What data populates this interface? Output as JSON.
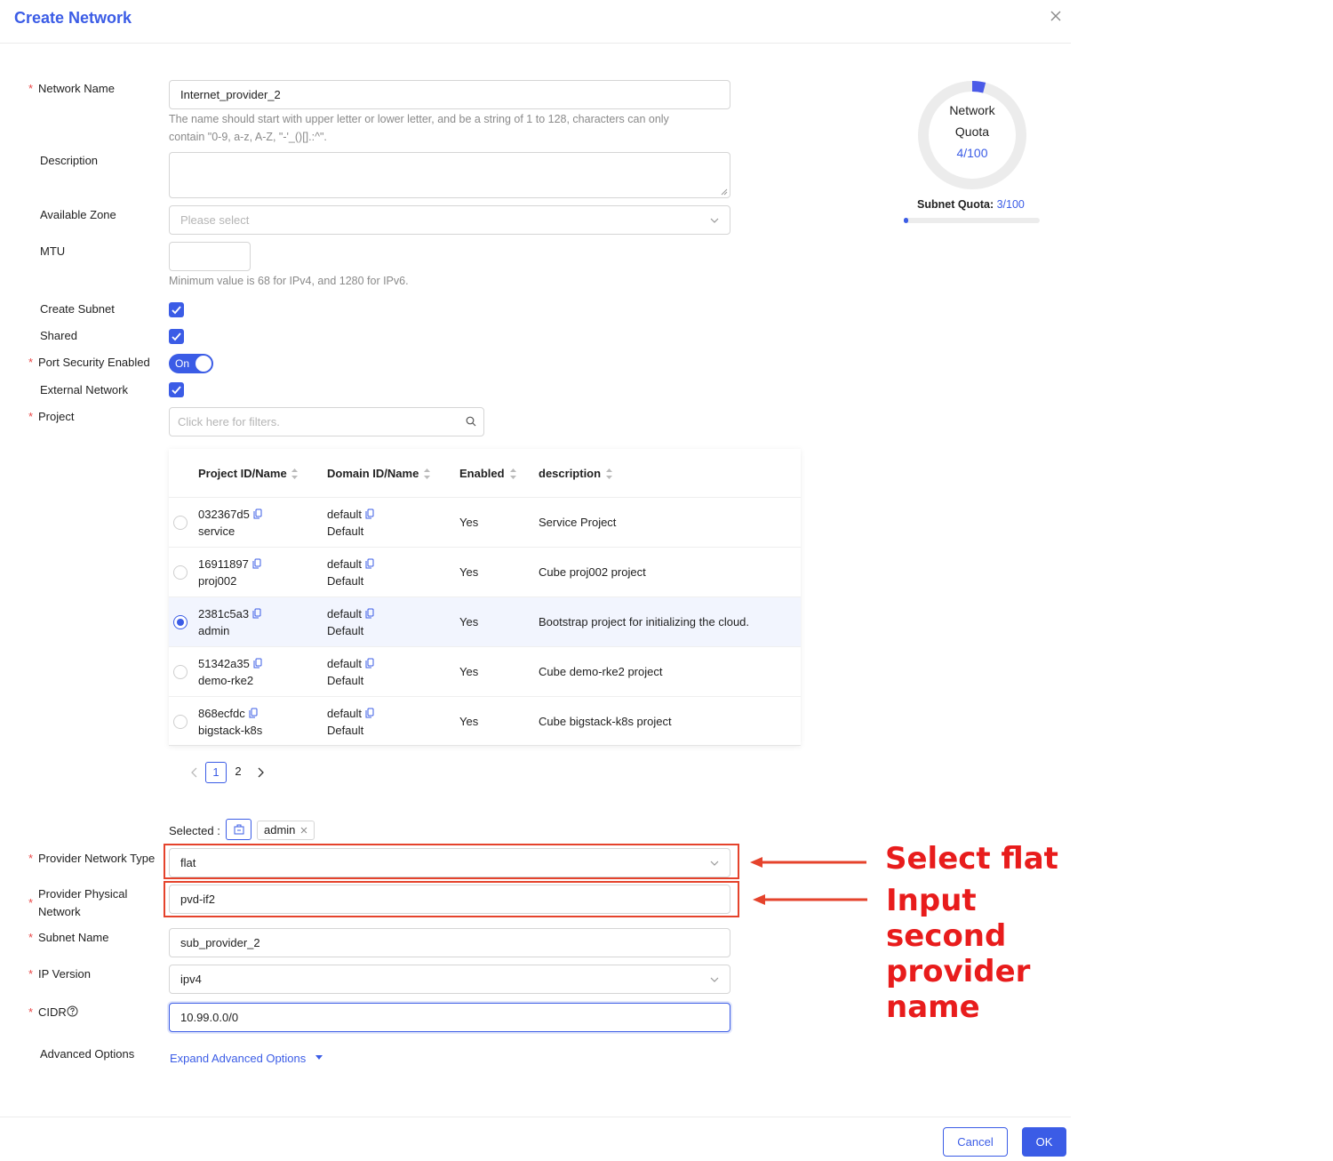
{
  "dialog": {
    "title": "Create Network"
  },
  "form": {
    "network_name": {
      "label": "Network Name",
      "value": "Internet_provider_2",
      "hint_line1": "The name should start with upper letter or lower letter, and be a string of 1 to 128, characters can only",
      "hint_line2": "contain \"0-9, a-z, A-Z, \"-'_()[].:^\"."
    },
    "description": {
      "label": "Description",
      "value": ""
    },
    "available_zone": {
      "label": "Available Zone",
      "placeholder": "Please select"
    },
    "mtu": {
      "label": "MTU",
      "value": "",
      "hint": "Minimum value is 68 for IPv4, and 1280 for IPv6."
    },
    "create_subnet": {
      "label": "Create Subnet",
      "checked": true
    },
    "shared": {
      "label": "Shared",
      "checked": true
    },
    "port_security": {
      "label": "Port Security Enabled",
      "state": "On"
    },
    "external_network": {
      "label": "External Network",
      "checked": true
    },
    "project": {
      "label": "Project",
      "placeholder": "Click here for filters."
    },
    "selected_label": "Selected :",
    "selected_tag": "admin",
    "provider_network_type": {
      "label": "Provider Network Type",
      "value": "flat"
    },
    "provider_physical_network": {
      "label_line1": "Provider Physical",
      "label_line2": "Network",
      "value": "pvd-if2"
    },
    "subnet_name": {
      "label": "Subnet Name",
      "value": "sub_provider_2"
    },
    "ip_version": {
      "label": "IP Version",
      "value": "ipv4"
    },
    "cidr": {
      "label": "CIDR",
      "value": "10.99.0.0/0"
    },
    "advanced": {
      "label": "Advanced Options",
      "link": "Expand Advanced Options"
    }
  },
  "table": {
    "headers": [
      "Project ID/Name",
      "Domain ID/Name",
      "Enabled",
      "description"
    ],
    "rows": [
      {
        "id": "032367d5",
        "name": "service",
        "domain_id": "default",
        "domain_name": "Default",
        "enabled": "Yes",
        "description": "Service Project",
        "selected": false
      },
      {
        "id": "16911897",
        "name": "proj002",
        "domain_id": "default",
        "domain_name": "Default",
        "enabled": "Yes",
        "description": "Cube proj002 project",
        "selected": false
      },
      {
        "id": "2381c5a3",
        "name": "admin",
        "domain_id": "default",
        "domain_name": "Default",
        "enabled": "Yes",
        "description": "Bootstrap project for initializing the cloud.",
        "selected": true
      },
      {
        "id": "51342a35",
        "name": "demo-rke2",
        "domain_id": "default",
        "domain_name": "Default",
        "enabled": "Yes",
        "description": "Cube demo-rke2 project",
        "selected": false
      },
      {
        "id": "868ecfdc",
        "name": "bigstack-k8s",
        "domain_id": "default",
        "domain_name": "Default",
        "enabled": "Yes",
        "description": "Cube bigstack-k8s project",
        "selected": false
      }
    ],
    "pages": [
      "1",
      "2"
    ],
    "current_page": "1"
  },
  "quota": {
    "network_line1": "Network",
    "network_line2": "Quota",
    "network_value": "4/100",
    "network_used": 4,
    "network_total": 100,
    "subnet_label": "Subnet Quota:",
    "subnet_value": "3/100",
    "subnet_used": 3,
    "subnet_total": 100
  },
  "annotations": {
    "select_flat": "Select flat",
    "input_provider": "Input second provider name"
  },
  "footer": {
    "cancel": "Cancel",
    "ok": "OK"
  },
  "colors": {
    "accent": "#3b5ce6",
    "required": "#e94646",
    "annotation": "#e81c1c"
  }
}
